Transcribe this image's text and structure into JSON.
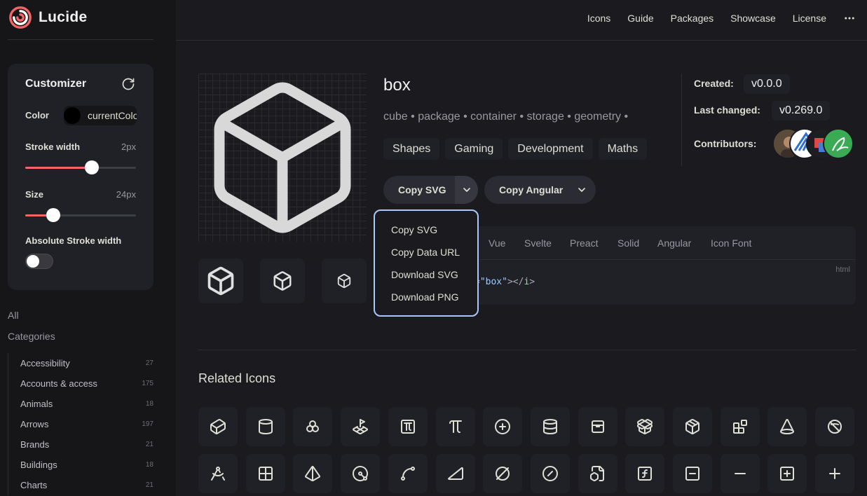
{
  "app": {
    "name": "Lucide"
  },
  "topnav": {
    "icons": "Icons",
    "guide": "Guide",
    "packages": "Packages",
    "showcase": "Showcase",
    "license": "License"
  },
  "customizer": {
    "title": "Customizer",
    "color_label": "Color",
    "color_value": "currentColor",
    "stroke_label": "Stroke width",
    "stroke_value": "2px",
    "stroke_fraction": 0.6,
    "size_label": "Size",
    "size_value": "24px",
    "size_fraction": 0.25,
    "abs_label": "Absolute Stroke width",
    "abs_enabled": false
  },
  "sidebar": {
    "all": "All",
    "categories_title": "Categories",
    "categories": [
      {
        "name": "Accessibility",
        "count": "27"
      },
      {
        "name": "Accounts & access",
        "count": "175"
      },
      {
        "name": "Animals",
        "count": "18"
      },
      {
        "name": "Arrows",
        "count": "197"
      },
      {
        "name": "Brands",
        "count": "21"
      },
      {
        "name": "Buildings",
        "count": "18"
      },
      {
        "name": "Charts",
        "count": "21"
      }
    ]
  },
  "icon": {
    "name": "box",
    "tags": "cube • package • container • storage • geometry •",
    "categories": [
      "Shapes",
      "Gaming",
      "Development",
      "Maths"
    ]
  },
  "info": {
    "created_label": "Created:",
    "created_value": "v0.0.0",
    "changed_label": "Last changed:",
    "changed_value": "v0.269.0",
    "contributors_label": "Contributors:"
  },
  "copy": {
    "svg_label": "Copy SVG",
    "angular_label": "Copy Angular"
  },
  "dropdown": [
    "Copy SVG",
    "Copy Data URL",
    "Download SVG",
    "Download PNG"
  ],
  "code": {
    "tabs": [
      "Vue",
      "Svelte",
      "Preact",
      "Solid",
      "Angular",
      "Icon Font"
    ],
    "line_pre": "=",
    "line_str": "\"box\"",
    "line_post": "></",
    "line_tag": "i",
    "line_end": ">",
    "lang": "html"
  },
  "related": {
    "title": "Related Icons"
  },
  "colors": {
    "accent": "#f56565",
    "dropdown_border": "#a8c7fa",
    "background": "#1b1b1f"
  }
}
